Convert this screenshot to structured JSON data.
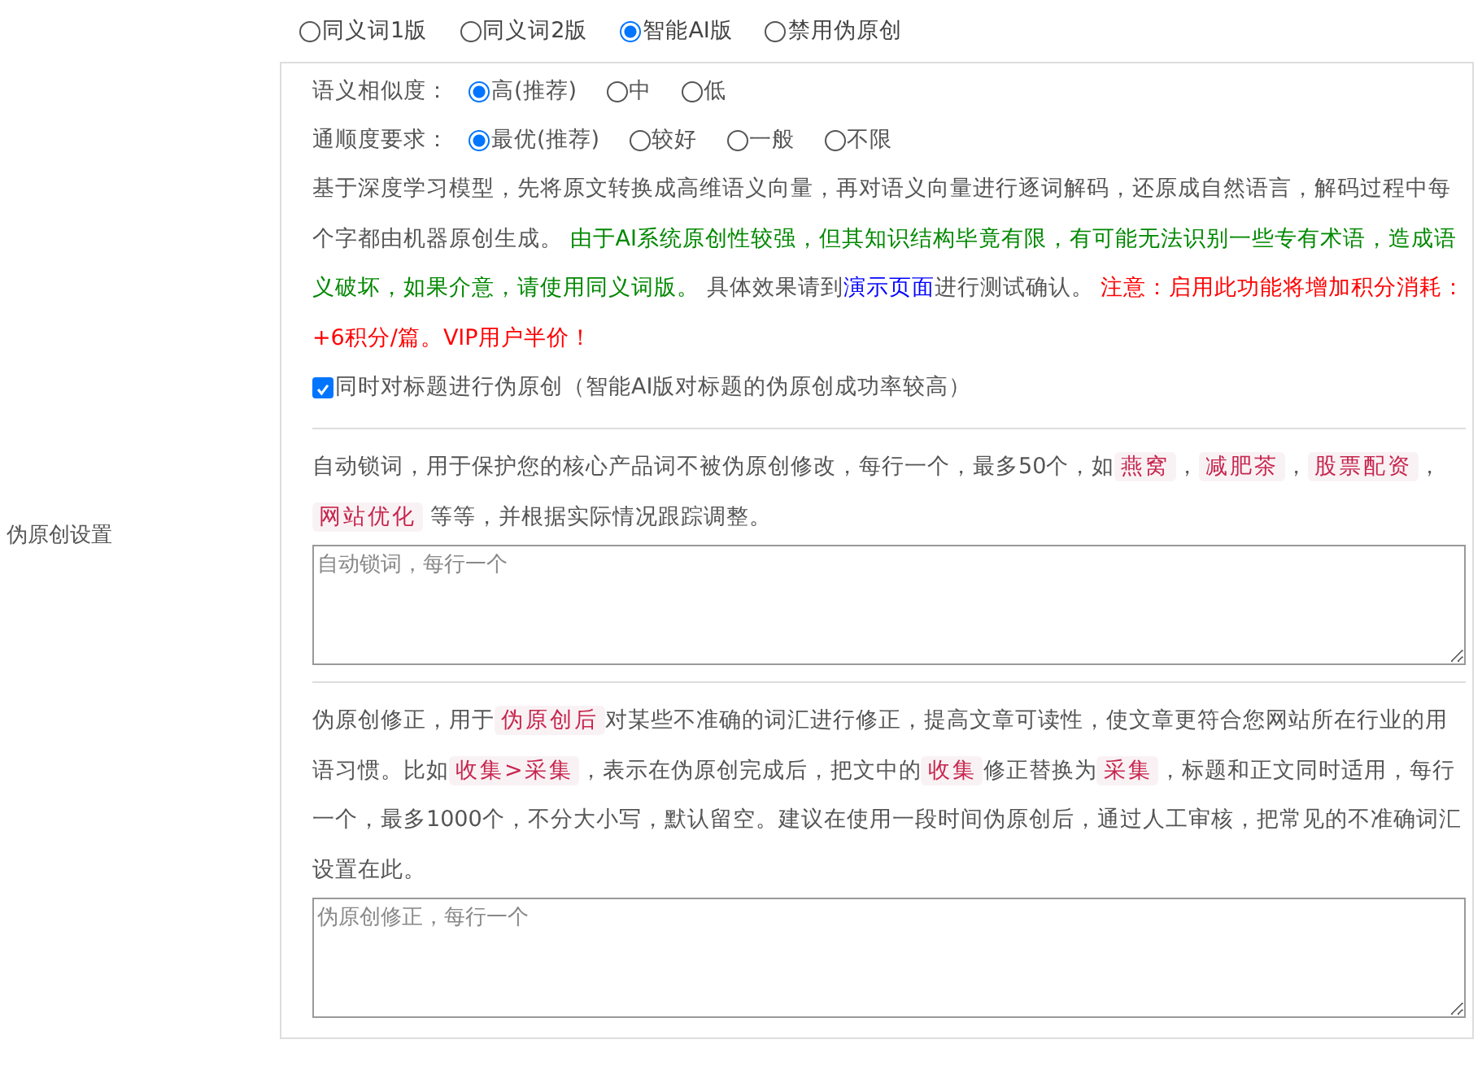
{
  "side_label": "伪原创设置",
  "versions": [
    {
      "label": "同义词1版",
      "selected": false
    },
    {
      "label": "同义词2版",
      "selected": false
    },
    {
      "label": "智能AI版",
      "selected": true
    },
    {
      "label": "禁用伪原创",
      "selected": false
    }
  ],
  "similarity": {
    "label": "语义相似度：",
    "options": [
      {
        "label": "高(推荐)",
        "selected": true
      },
      {
        "label": "中",
        "selected": false
      },
      {
        "label": "低",
        "selected": false
      }
    ]
  },
  "fluency": {
    "label": "通顺度要求：",
    "options": [
      {
        "label": "最优(推荐)",
        "selected": true
      },
      {
        "label": "较好",
        "selected": false
      },
      {
        "label": "一般",
        "selected": false
      },
      {
        "label": "不限",
        "selected": false
      }
    ]
  },
  "ai_description": [
    {
      "kind": "text",
      "text": "基于深度学习模型，先将原文转换成高维语义向量，再对语义向量进行逐词解码，还原成自然语言，解码过程中每个字都由机器原创生成。 "
    },
    {
      "kind": "note",
      "text": "由于AI系统原创性较强，但其知识结构毕竟有限，有可能无法识别一些专有术语，造成语义破坏，如果介意，请使用同义词版。"
    },
    {
      "kind": "text",
      "text": " 具体效果请到"
    },
    {
      "kind": "link",
      "text": "演示页面"
    },
    {
      "kind": "text",
      "text": "进行测试确认。 "
    },
    {
      "kind": "warning",
      "text": "注意：启用此功能将增加积分消耗：+6积分/篇。VIP用户半价！"
    }
  ],
  "title_checkbox": {
    "label": "同时对标题进行伪原创（智能AI版对标题的伪原创成功率较高）",
    "checked": true
  },
  "lock_words": {
    "description": [
      {
        "kind": "text",
        "text": "自动锁词，用于保护您的核心产品词不被伪原创修改，每行一个，最多50个，如"
      },
      {
        "kind": "code",
        "text": "燕窝"
      },
      {
        "kind": "text",
        "text": "，"
      },
      {
        "kind": "code",
        "text": "减肥茶"
      },
      {
        "kind": "text",
        "text": "，"
      },
      {
        "kind": "code",
        "text": "股票配资"
      },
      {
        "kind": "text",
        "text": "，"
      },
      {
        "kind": "code",
        "text": "网站优化"
      },
      {
        "kind": "text",
        "text": " 等等，并根据实际情况跟踪调整。"
      }
    ],
    "placeholder": "自动锁词，每行一个"
  },
  "correction": {
    "description": [
      {
        "kind": "text",
        "text": "伪原创修正，用于"
      },
      {
        "kind": "code",
        "text": "伪原创后"
      },
      {
        "kind": "text",
        "text": "对某些不准确的词汇进行修正，提高文章可读性，使文章更符合您网站所在行业的用语习惯。比如"
      },
      {
        "kind": "code",
        "text": "收集>采集"
      },
      {
        "kind": "text",
        "text": "，表示在伪原创完成后，把文中的"
      },
      {
        "kind": "code",
        "text": "收集"
      },
      {
        "kind": "text",
        "text": "修正替换为"
      },
      {
        "kind": "code",
        "text": "采集"
      },
      {
        "kind": "text",
        "text": "，标题和正文同时适用，每行一个，最多1000个，不分大小写，默认留空。建议在使用一段时间伪原创后，通过人工审核，把常见的不准确词汇设置在此。"
      }
    ],
    "placeholder": "伪原创修正，每行一个"
  }
}
